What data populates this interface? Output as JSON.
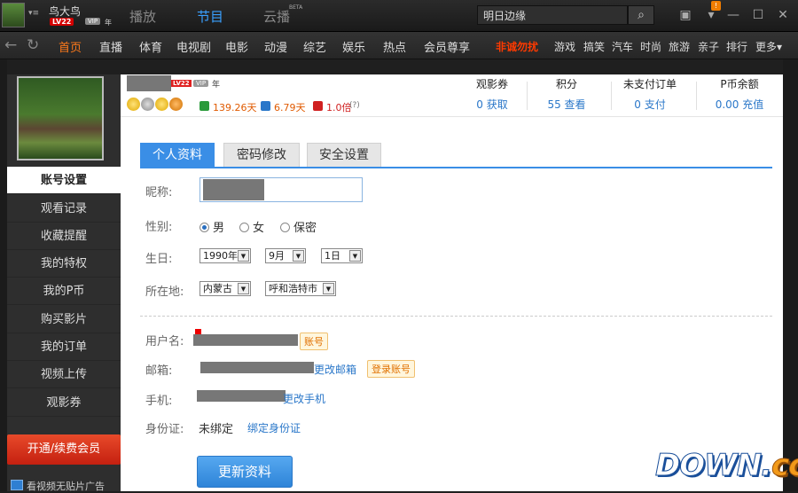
{
  "topbar": {
    "username": "鸟大鸟",
    "level_badge": "LV22",
    "vip_small": "VIP",
    "year_small": "年",
    "tabs": [
      "播放",
      "节目",
      "云播"
    ],
    "beta": "BETA",
    "search_value": "明日边缘",
    "notification_count": "!"
  },
  "nav": {
    "items": [
      "首页",
      "直播",
      "体育",
      "电视剧",
      "电影",
      "动漫",
      "综艺",
      "娱乐",
      "热点",
      "会员尊享"
    ],
    "promo": "非诚勿扰",
    "small_items": [
      "游戏",
      "搞笑",
      "汽车",
      "时尚",
      "旅游",
      "亲子",
      "排行",
      "更多"
    ]
  },
  "sidebar": {
    "items": [
      "账号设置",
      "观看记录",
      "收藏提醒",
      "我的特权",
      "我的P币",
      "购买影片",
      "我的订单",
      "视频上传",
      "观影券"
    ],
    "vip_button": "开通/续费会员",
    "ad_text": "看视频无贴片广告"
  },
  "profile": {
    "level": "LV22",
    "vip": "VIP",
    "year": "年",
    "stats": [
      {
        "value": "139.26天",
        "icon": "clock-icon",
        "color": "#2a9a3a"
      },
      {
        "value": "6.79天",
        "icon": "speed-icon",
        "color": "#2a77c9"
      },
      {
        "value": "1.0倍",
        "icon": "multiplier-icon",
        "color": "#d02020"
      }
    ],
    "help": "(?)"
  },
  "account": [
    {
      "label": "观影券",
      "value": "0",
      "action": "获取"
    },
    {
      "label": "积分",
      "value": "55",
      "action": "查看"
    },
    {
      "label": "未支付订单",
      "value": "0",
      "action": "支付"
    },
    {
      "label": "P币余额",
      "value": "0.00",
      "action": "充值"
    }
  ],
  "tabs": [
    "个人资料",
    "密码修改",
    "安全设置"
  ],
  "form": {
    "nickname_label": "昵称:",
    "gender_label": "性别:",
    "gender_options": [
      "男",
      "女",
      "保密"
    ],
    "birthday_label": "生日:",
    "birthday": {
      "year": "1990年",
      "month": "9月",
      "day": "1日"
    },
    "location_label": "所在地:",
    "location": {
      "province": "内蒙古",
      "city": "呼和浩特市"
    },
    "username_label": "用户名:",
    "username_badge": "账号",
    "email_label": "邮箱:",
    "email_action": "更改邮箱",
    "email_badge": "登录账号",
    "phone_label": "手机:",
    "phone_action": "更改手机",
    "id_label": "身份证:",
    "id_status": "未绑定",
    "id_action": "绑定身份证",
    "submit": "更新资料"
  },
  "watermark": {
    "main": "DOWN.",
    "suffix": "cc"
  }
}
